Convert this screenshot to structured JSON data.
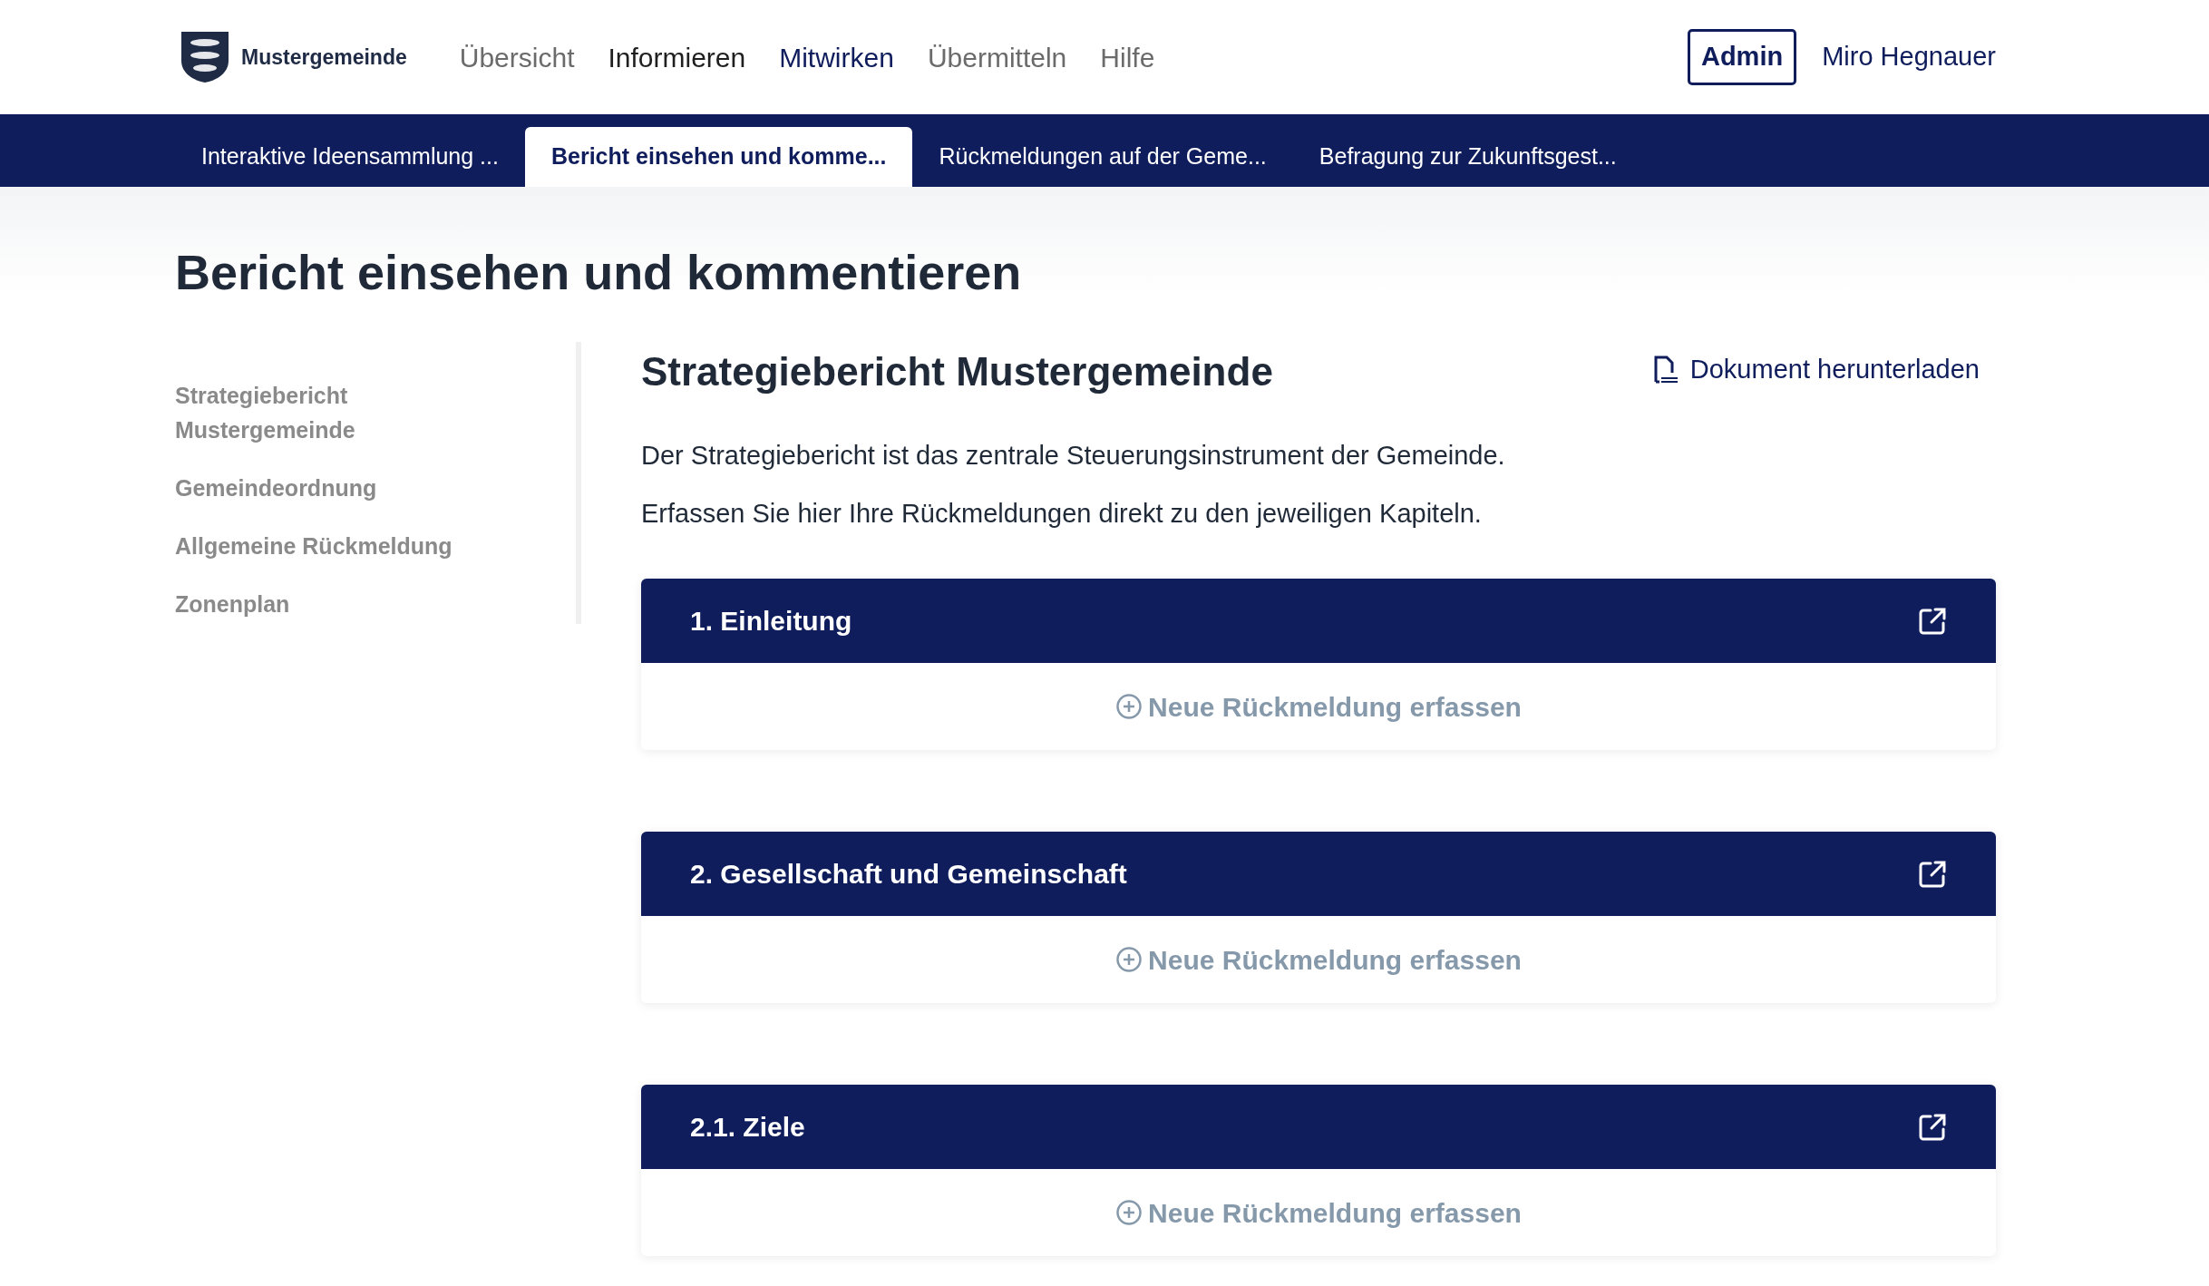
{
  "header": {
    "logo_text": "Mustergemeinde",
    "nav": [
      {
        "label": "Übersicht",
        "kind": "muted"
      },
      {
        "label": "Informieren",
        "kind": "dark"
      },
      {
        "label": "Mitwirken",
        "kind": "active"
      },
      {
        "label": "Übermitteln",
        "kind": "muted"
      },
      {
        "label": "Hilfe",
        "kind": "muted"
      }
    ],
    "admin_button": "Admin",
    "user_name": "Miro Hegnauer"
  },
  "tabs": [
    {
      "label": "Interaktive Ideensammlung ...",
      "selected": false
    },
    {
      "label": "Bericht einsehen und komme...",
      "selected": true
    },
    {
      "label": "Rückmeldungen auf der Geme...",
      "selected": false
    },
    {
      "label": "Befragung zur Zukunftsgest...",
      "selected": false
    }
  ],
  "page_title": "Bericht einsehen und kommentieren",
  "sidebar": {
    "items": [
      {
        "label": "Strategiebericht Mustergemeinde"
      },
      {
        "label": "Gemeindeordnung"
      },
      {
        "label": "Allgemeine Rückmeldung"
      },
      {
        "label": "Zonenplan"
      }
    ]
  },
  "document": {
    "title": "Strategiebericht Mustergemeinde",
    "download_link": "Dokument herunterladen",
    "description": [
      "Der Strategiebericht ist das zentrale Steuerungsinstrument der Gemeinde.",
      "Erfassen Sie hier Ihre Rückmeldungen direkt zu den jeweiligen Kapiteln."
    ],
    "chapters": [
      {
        "title": "1. Einleitung",
        "action": "Neue Rückmeldung erfassen"
      },
      {
        "title": "2. Gesellschaft und Gemeinschaft",
        "action": "Neue Rückmeldung erfassen"
      },
      {
        "title": "2.1. Ziele",
        "action": "Neue Rückmeldung erfassen"
      }
    ]
  }
}
